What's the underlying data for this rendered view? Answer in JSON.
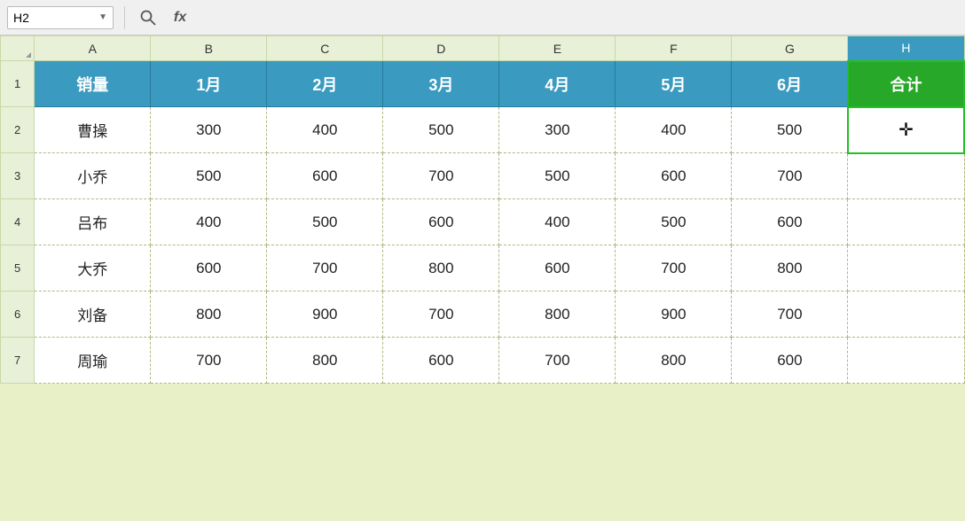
{
  "namebox": {
    "value": "H2",
    "chevron": "▼"
  },
  "formulabar": {
    "icon": "fx",
    "value": ""
  },
  "columns": {
    "headers": [
      "A",
      "B",
      "C",
      "D",
      "E",
      "F",
      "G",
      "H"
    ],
    "selected": "H"
  },
  "rows": {
    "header": {
      "cells": [
        "销量",
        "1月",
        "2月",
        "3月",
        "4月",
        "5月",
        "6月",
        "合计"
      ]
    },
    "data": [
      {
        "num": 2,
        "name": "曹操",
        "b": 300,
        "c": 400,
        "d": 500,
        "e": 300,
        "f": 400,
        "g": 500,
        "h": ""
      },
      {
        "num": 3,
        "name": "小乔",
        "b": 500,
        "c": 600,
        "d": 700,
        "e": 500,
        "f": 600,
        "g": 700,
        "h": ""
      },
      {
        "num": 4,
        "name": "吕布",
        "b": 400,
        "c": 500,
        "d": 600,
        "e": 400,
        "f": 500,
        "g": 600,
        "h": ""
      },
      {
        "num": 5,
        "name": "大乔",
        "b": 600,
        "c": 700,
        "d": 800,
        "e": 600,
        "f": 700,
        "g": 800,
        "h": ""
      },
      {
        "num": 6,
        "name": "刘备",
        "b": 800,
        "c": 900,
        "d": 700,
        "e": 800,
        "f": 900,
        "g": 700,
        "h": ""
      },
      {
        "num": 7,
        "name": "周瑜",
        "b": 700,
        "c": 800,
        "d": 600,
        "e": 700,
        "f": 800,
        "g": 600,
        "h": ""
      }
    ]
  },
  "cursor_symbol": "✛",
  "colors": {
    "teal_header": "#3a9abf",
    "green_h_col": "#28a828",
    "row_header_bg": "#e8f0d8",
    "body_bg": "#e8f0c8"
  }
}
